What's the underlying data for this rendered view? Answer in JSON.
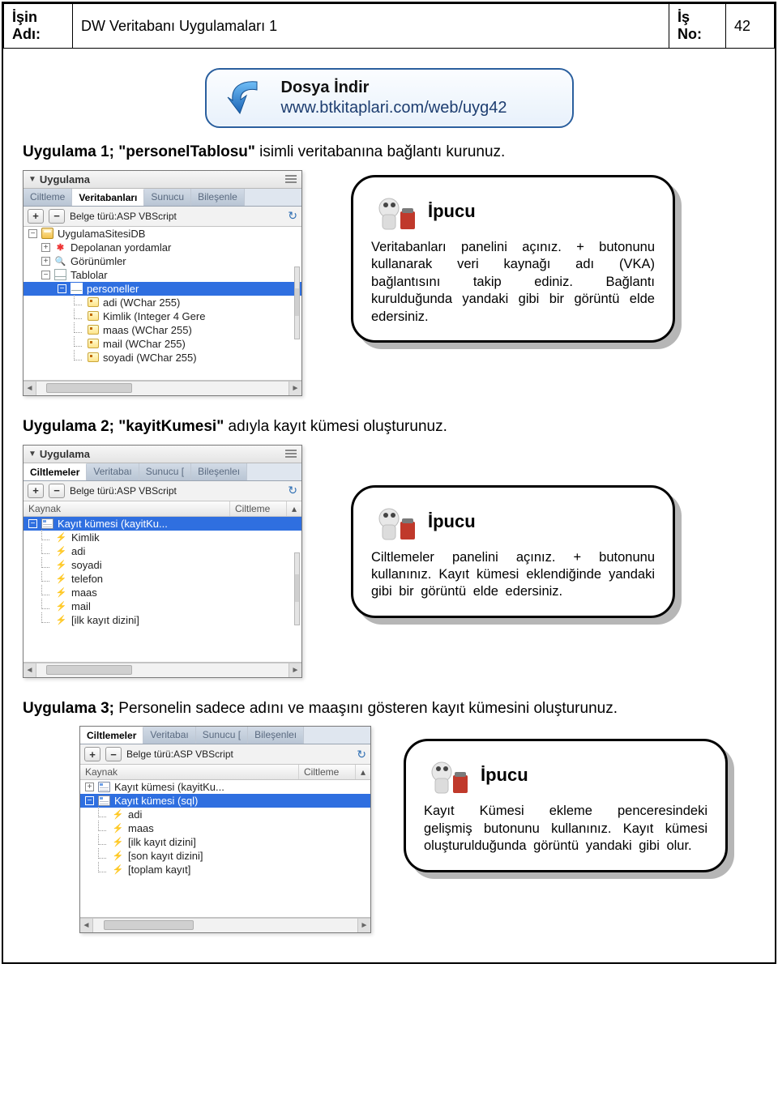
{
  "header": {
    "isin_adi_label": "İşin Adı:",
    "title": "DW Veritabanı Uygulamaları 1",
    "is_no_label": "İş No:",
    "is_no": "42"
  },
  "download": {
    "title": "Dosya İndir",
    "url": "www.btkitaplari.com/web/uyg42"
  },
  "uyg1": {
    "prefix": "Uygulama 1; ",
    "bold": "\"personelTablosu\"",
    "suffix": " isimli veritabanına bağlantı kurunuz."
  },
  "panel1": {
    "title": "Uygulama",
    "tabs": [
      "Ciltleme",
      "Veritabanları",
      "Sunucu",
      "Bileşenle"
    ],
    "activeTab": 1,
    "toolbar_label": "Belge türü:ASP VBScript",
    "tree": {
      "root": "UygulamaSitesiDB",
      "sp": "Depolanan yordamlar",
      "views": "Görünümler",
      "tables": "Tablolar",
      "table1": "personeller",
      "cols": [
        "adi (WChar 255)",
        "Kimlik (Integer 4 Gere",
        "maas (WChar 255)",
        "mail (WChar 255)",
        "soyadi (WChar 255)"
      ]
    }
  },
  "ipucu1": {
    "title": "İpucu",
    "text": "Veritabanları panelini açınız. + butonunu kullanarak veri kaynağı adı (VKA) bağlantısını takip ediniz. Bağlantı kurulduğunda yandaki gibi bir görüntü elde edersiniz."
  },
  "uyg2": {
    "prefix": "Uygulama 2; ",
    "bold": "\"kayitKumesi\"",
    "suffix": " adıyla kayıt kümesi oluşturunuz."
  },
  "panel2": {
    "title": "Uygulama",
    "tabs": [
      "Ciltlemeler",
      "Veritabaı",
      "Sunucu [",
      "Bileşenleı"
    ],
    "activeTab": 0,
    "toolbar_label": "Belge türü:ASP VBScript",
    "heads": [
      "Kaynak",
      "Ciltleme"
    ],
    "recordset": "Kayıt kümesi (kayitKu...",
    "fields": [
      "Kimlik",
      "adi",
      "soyadi",
      "telefon",
      "maas",
      "mail",
      "[ilk kayıt dizini]"
    ]
  },
  "ipucu2": {
    "title": "İpucu",
    "text": "Ciltlemeler panelini açınız. + butonunu kullanınız. Kayıt kümesi eklendiğinde yandaki gibi bir görüntü elde edersiniz."
  },
  "uyg3": {
    "prefix": "Uygulama 3; ",
    "suffix": "Personelin sadece adını ve maaşını gösteren kayıt kümesini oluşturunuz."
  },
  "panel3": {
    "tabs": [
      "Ciltlemeler",
      "Veritabaı",
      "Sunucu [",
      "Bileşenleı"
    ],
    "activeTab": 0,
    "toolbar_label": "Belge türü:ASP VBScript",
    "heads": [
      "Kaynak",
      "Ciltleme"
    ],
    "rs_closed": "Kayıt kümesi (kayitKu...",
    "rs_open": "Kayıt kümesi (sql)",
    "fields": [
      "adi",
      "maas",
      "[ilk kayıt dizini]",
      "[son kayıt dizini]",
      "[toplam kayıt]"
    ]
  },
  "ipucu3": {
    "title": "İpucu",
    "text": "Kayıt Kümesi ekleme penceresindeki gelişmiş butonunu kullanınız. Kayıt kümesi oluşturulduğunda görüntü yandaki gibi olur."
  }
}
